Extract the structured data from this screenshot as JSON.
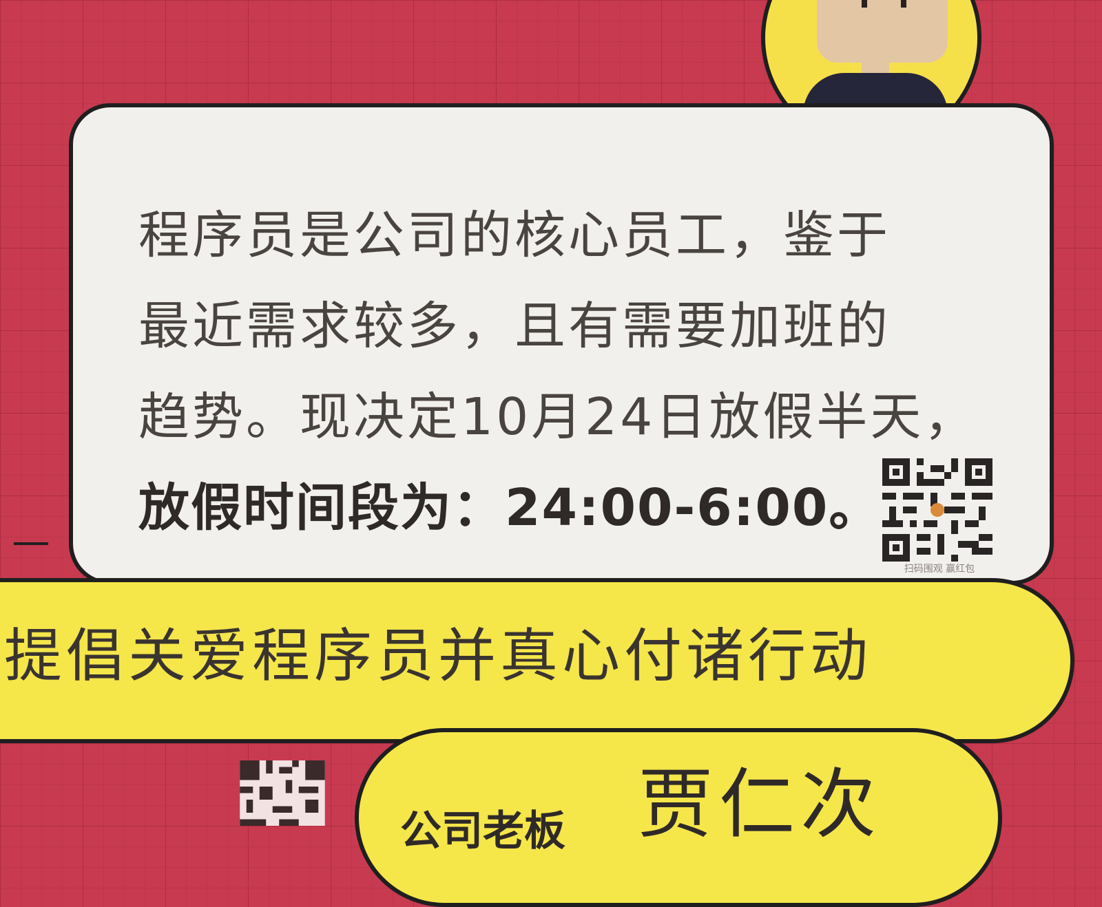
{
  "notice": {
    "line1": "程序员是公司的核心员工，鉴于",
    "line2": "最近需求较多，且有需要加班的",
    "line3": "趋势。现决定10月24日放假半天，",
    "line4": "放假时间段为：24:00-6:00。"
  },
  "qr": {
    "caption": "扫码围观 赢红包"
  },
  "slogan": "提倡关爱程序员并真心付诸行动",
  "signature": {
    "label": "公司老板",
    "name": "贾仁次"
  },
  "colors": {
    "background": "#c73a50",
    "bubble": "#f2f0ec",
    "accent_yellow": "#f5e64a",
    "outline": "#1f1f1f"
  }
}
